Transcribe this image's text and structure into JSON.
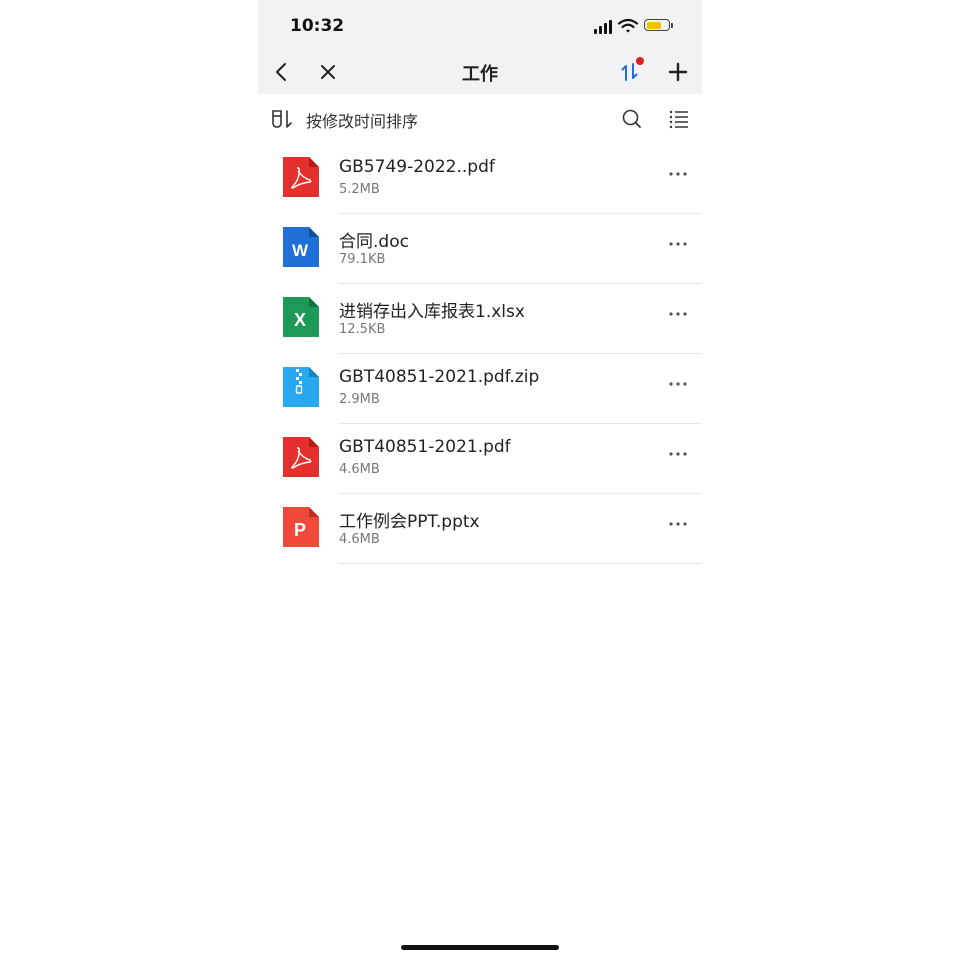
{
  "status_bar": {
    "time": "10:32"
  },
  "nav": {
    "title": "工作"
  },
  "toolbar": {
    "sort_label": "按修改时间排序"
  },
  "files": [
    {
      "name": "GB5749-2022..pdf",
      "size": "5.2MB",
      "type": "pdf",
      "color": "#e3302c"
    },
    {
      "name": "合同.doc",
      "size": "79.1KB",
      "type": "word",
      "color": "#1f6fd6",
      "letter": "W"
    },
    {
      "name": "进销存出入库报表1.xlsx",
      "size": "12.5KB",
      "type": "excel",
      "color": "#1d9a58",
      "letter": "X"
    },
    {
      "name": "GBT40851-2021.pdf.zip",
      "size": "2.9MB",
      "type": "zip",
      "color": "#29a8f2"
    },
    {
      "name": "GBT40851-2021.pdf",
      "size": "4.6MB",
      "type": "pdf",
      "color": "#e3302c"
    },
    {
      "name": "工作例会PPT.pptx",
      "size": "4.6MB",
      "type": "ppt",
      "color": "#f0493a",
      "letter": "P"
    }
  ],
  "colors": {
    "accent": "#1f6fd6",
    "badge": "#e02020",
    "battery": "#f2c200"
  }
}
